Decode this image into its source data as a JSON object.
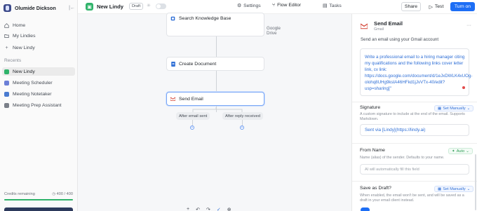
{
  "sidebar": {
    "user_name": "Olumide Dickson",
    "nav": [
      {
        "label": "Home",
        "icon": "home-icon"
      },
      {
        "label": "My Lindies",
        "icon": "folder-icon"
      },
      {
        "label": "New Lindy",
        "icon": "plus-icon"
      }
    ],
    "recents_label": "Recents",
    "recents": [
      {
        "label": "New Lindy",
        "color": "#2fb36a",
        "active": true
      },
      {
        "label": "Meeting Scheduler",
        "color": "#6b7fd7",
        "active": false
      },
      {
        "label": "Meeting Notetaker",
        "color": "#4a7bd0",
        "active": false
      },
      {
        "label": "Meeting Prep Assistant",
        "color": "#7a7f88",
        "active": false
      }
    ],
    "credits_label": "Credits remaining",
    "credits_value": "400 / 400",
    "credits_fraction": 1.0
  },
  "topbar": {
    "title": "New Lindy",
    "status_badge": "Draft",
    "tabs": [
      {
        "label": "Settings",
        "icon": "gear-icon",
        "active": false
      },
      {
        "label": "Flow Editor",
        "icon": "flow-icon",
        "active": true
      },
      {
        "label": "Tasks",
        "icon": "tasks-icon",
        "active": false
      }
    ],
    "share_label": "Share",
    "test_label": "Test",
    "turn_on_label": "Turn on"
  },
  "canvas": {
    "nodes": [
      {
        "label": "Search Knowledge Base",
        "sub": "Google Drive",
        "icon": "knowledge-base-icon"
      },
      {
        "label": "Create Document",
        "icon": "google-docs-icon"
      },
      {
        "label": "Send Email",
        "icon": "gmail-icon"
      }
    ],
    "branches": [
      "After email sent",
      "After reply received"
    ]
  },
  "panel": {
    "title": "Send Email",
    "subtitle": "Gmail",
    "description": "Send an email using your Gmail account",
    "prompt": "Write a professional email to a hiring manager citing my qualifications and the following links cover letter link, cv link: https://docs.google.com/document/d/1eJxDWLK4xUOg-olohq8UHg9ksIA46HFkd1jJvVTx-40/edit?usp=sharing]\"",
    "signature": {
      "label": "Signature",
      "mode": "Set Manually",
      "help": "A custom signature to include at the end of the email. Supports Markdown.",
      "value": "Sent via [Lindy](https://lindy.ai)"
    },
    "from_name": {
      "label": "From Name",
      "mode": "Auto",
      "help": "Name (alias) of the sender. Defaults to your name.",
      "placeholder": "AI will automatically fill this field"
    },
    "save_as_draft": {
      "label": "Save as Draft?",
      "mode": "Set Manually",
      "help": "When enabled, the email won't be sent, and will be saved as a draft in your email client instead.",
      "enabled": true
    }
  },
  "colors": {
    "accent": "#1d6ef5",
    "lindy_green": "#2fb36a",
    "link_blue": "#2f6fd6"
  }
}
